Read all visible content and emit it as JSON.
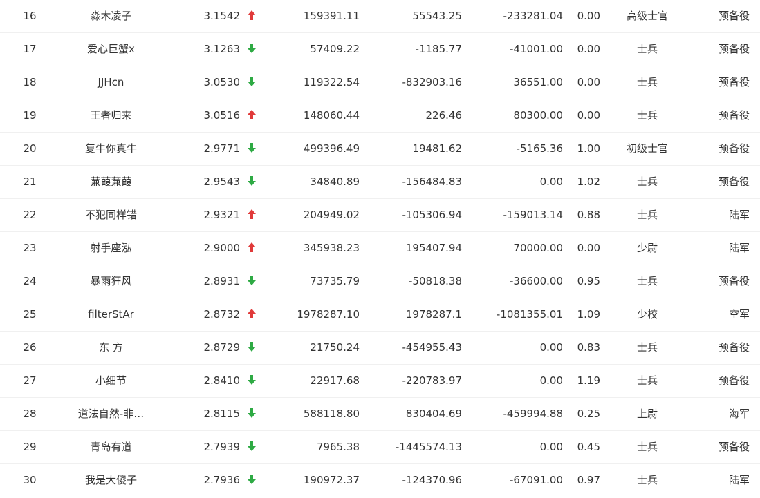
{
  "colors": {
    "up": "#e03a3a",
    "down": "#2eaa44",
    "text": "#333333"
  },
  "rows": [
    {
      "rank": "16",
      "name": "淼木凌子",
      "score": "3.1542",
      "trend": "up",
      "v1": "159391.11",
      "v2": "55543.25",
      "v3": "-233281.04",
      "v4": "0.00",
      "title": "高级士官",
      "branch": "预备役"
    },
    {
      "rank": "17",
      "name": "爱心巨蟹x",
      "score": "3.1263",
      "trend": "down",
      "v1": "57409.22",
      "v2": "-1185.77",
      "v3": "-41001.00",
      "v4": "0.00",
      "title": "士兵",
      "branch": "预备役"
    },
    {
      "rank": "18",
      "name": "JJHcn",
      "score": "3.0530",
      "trend": "down",
      "v1": "119322.54",
      "v2": "-832903.16",
      "v3": "36551.00",
      "v4": "0.00",
      "title": "士兵",
      "branch": "预备役"
    },
    {
      "rank": "19",
      "name": "王者归来",
      "score": "3.0516",
      "trend": "up",
      "v1": "148060.44",
      "v2": "226.46",
      "v3": "80300.00",
      "v4": "0.00",
      "title": "士兵",
      "branch": "预备役"
    },
    {
      "rank": "20",
      "name": "复牛你真牛",
      "score": "2.9771",
      "trend": "down",
      "v1": "499396.49",
      "v2": "19481.62",
      "v3": "-5165.36",
      "v4": "1.00",
      "title": "初级士官",
      "branch": "预备役"
    },
    {
      "rank": "21",
      "name": "蒹葭蒹葭",
      "score": "2.9543",
      "trend": "down",
      "v1": "34840.89",
      "v2": "-156484.83",
      "v3": "0.00",
      "v4": "1.02",
      "title": "士兵",
      "branch": "预备役"
    },
    {
      "rank": "22",
      "name": "不犯同样错",
      "score": "2.9321",
      "trend": "up",
      "v1": "204949.02",
      "v2": "-105306.94",
      "v3": "-159013.14",
      "v4": "0.88",
      "title": "士兵",
      "branch": "陆军"
    },
    {
      "rank": "23",
      "name": "射手座泓",
      "score": "2.9000",
      "trend": "up",
      "v1": "345938.23",
      "v2": "195407.94",
      "v3": "70000.00",
      "v4": "0.00",
      "title": "少尉",
      "branch": "陆军"
    },
    {
      "rank": "24",
      "name": "暴雨狂风",
      "score": "2.8931",
      "trend": "down",
      "v1": "73735.79",
      "v2": "-50818.38",
      "v3": "-36600.00",
      "v4": "0.95",
      "title": "士兵",
      "branch": "预备役"
    },
    {
      "rank": "25",
      "name": "filterStAr",
      "score": "2.8732",
      "trend": "up",
      "v1": "1978287.10",
      "v2": "1978287.1",
      "v3": "-1081355.01",
      "v4": "1.09",
      "title": "少校",
      "branch": "空军"
    },
    {
      "rank": "26",
      "name": "东 方",
      "score": "2.8729",
      "trend": "down",
      "v1": "21750.24",
      "v2": "-454955.43",
      "v3": "0.00",
      "v4": "0.83",
      "title": "士兵",
      "branch": "预备役"
    },
    {
      "rank": "27",
      "name": "小细节",
      "score": "2.8410",
      "trend": "down",
      "v1": "22917.68",
      "v2": "-220783.97",
      "v3": "0.00",
      "v4": "1.19",
      "title": "士兵",
      "branch": "预备役"
    },
    {
      "rank": "28",
      "name": "道法自然-非…",
      "score": "2.8115",
      "trend": "down",
      "v1": "588118.80",
      "v2": "830404.69",
      "v3": "-459994.88",
      "v4": "0.25",
      "title": "上尉",
      "branch": "海军"
    },
    {
      "rank": "29",
      "name": "青岛有道",
      "score": "2.7939",
      "trend": "down",
      "v1": "7965.38",
      "v2": "-1445574.13",
      "v3": "0.00",
      "v4": "0.45",
      "title": "士兵",
      "branch": "预备役"
    },
    {
      "rank": "30",
      "name": "我是大傻子",
      "score": "2.7936",
      "trend": "down",
      "v1": "190972.37",
      "v2": "-124370.96",
      "v3": "-67091.00",
      "v4": "0.97",
      "title": "士兵",
      "branch": "陆军"
    }
  ]
}
